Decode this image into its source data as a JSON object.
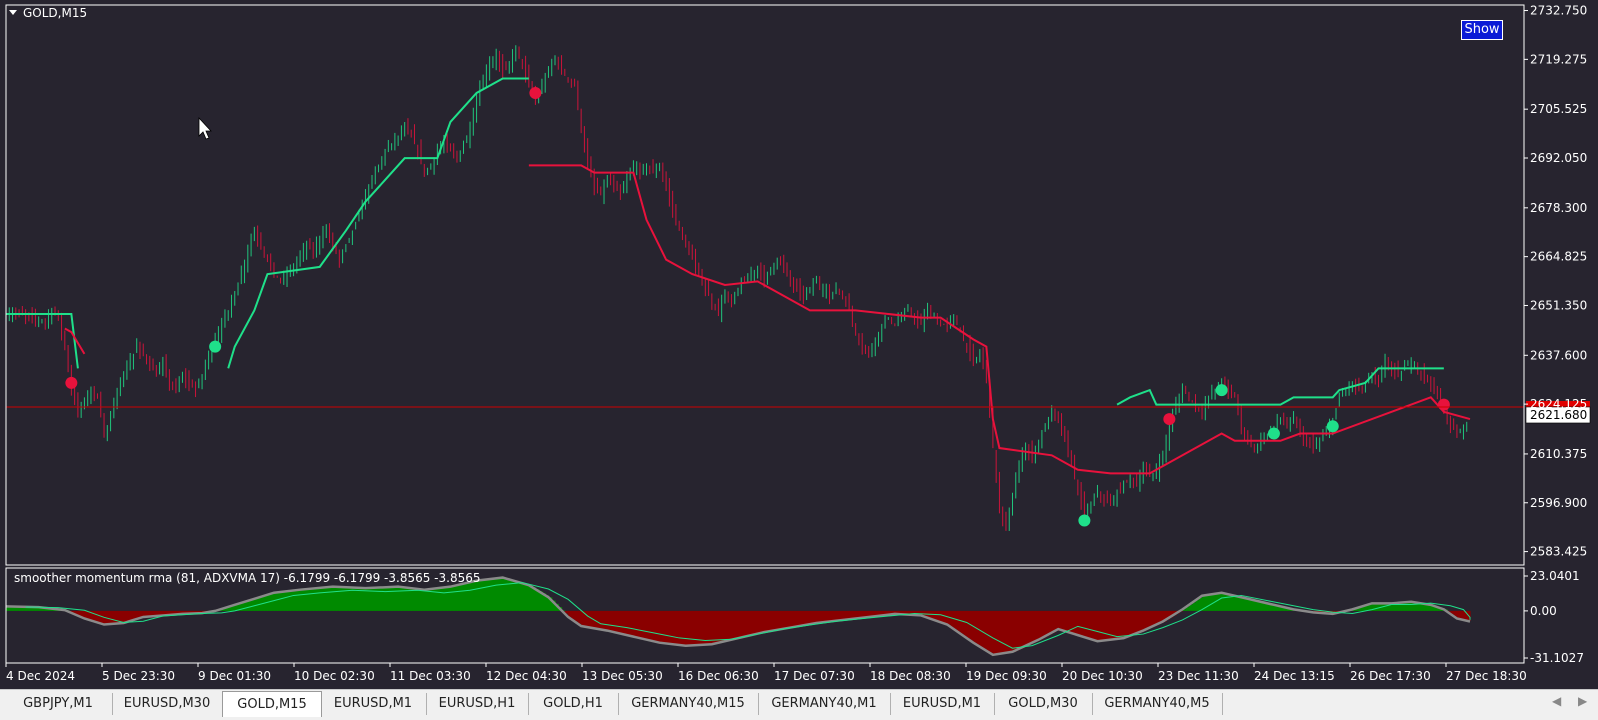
{
  "window": {
    "symbol_title": "GOLD,M15",
    "show_button": "Show"
  },
  "colors": {
    "background": "#27242f",
    "bull": "#1fe08a",
    "bear": "#e8123c",
    "hist_pos": "#008a00",
    "hist_neg": "#8a0000",
    "line_gray": "#8a8a8a",
    "price_line": "#cc0000"
  },
  "indicator": {
    "label": "smoother momentum rma (81, ADXVMA 17) -6.1799 -6.1799 -3.8565 -3.8565",
    "ticks": [
      "23.0401",
      "0.00",
      "-31.1027"
    ]
  },
  "chart_data": {
    "type": "candlestick",
    "price_axis": {
      "ticks": [
        "2732.750",
        "2719.275",
        "2705.525",
        "2692.050",
        "2678.300",
        "2664.825",
        "2651.350",
        "2637.600",
        "2624.125",
        "2610.375",
        "2596.900",
        "2583.425"
      ],
      "ylim": [
        2580.0,
        2734.0
      ],
      "current_price": "2621.680"
    },
    "time_axis": {
      "labels": [
        "4 Dec 2024",
        "5 Dec 23:30",
        "9 Dec 01:30",
        "10 Dec 02:30",
        "11 Dec 03:30",
        "12 Dec 04:30",
        "13 Dec 05:30",
        "16 Dec 06:30",
        "17 Dec 07:30",
        "18 Dec 08:30",
        "19 Dec 09:30",
        "20 Dec 10:30",
        "23 Dec 11:30",
        "24 Dec 13:15",
        "26 Dec 17:30",
        "27 Dec 18:30"
      ]
    },
    "price_path": [
      [
        0,
        2649
      ],
      [
        2,
        2649
      ],
      [
        4,
        2648
      ],
      [
        6,
        2647
      ],
      [
        7,
        2650
      ],
      [
        8,
        2648
      ],
      [
        9,
        2640
      ],
      [
        10,
        2628
      ],
      [
        11,
        2622
      ],
      [
        12,
        2625
      ],
      [
        13,
        2628
      ],
      [
        14,
        2626
      ],
      [
        15,
        2616
      ],
      [
        16,
        2620
      ],
      [
        17,
        2628
      ],
      [
        18,
        2632
      ],
      [
        19,
        2636
      ],
      [
        20,
        2640
      ],
      [
        21,
        2638
      ],
      [
        22,
        2635
      ],
      [
        23,
        2632
      ],
      [
        24,
        2635
      ],
      [
        25,
        2630
      ],
      [
        26,
        2628
      ],
      [
        27,
        2632
      ],
      [
        28,
        2630
      ],
      [
        29,
        2628
      ],
      [
        30,
        2632
      ],
      [
        31,
        2638
      ],
      [
        32,
        2642
      ],
      [
        33,
        2646
      ],
      [
        34,
        2650
      ],
      [
        35,
        2655
      ],
      [
        36,
        2660
      ],
      [
        37,
        2667
      ],
      [
        38,
        2672
      ],
      [
        39,
        2668
      ],
      [
        40,
        2664
      ],
      [
        41,
        2660
      ],
      [
        42,
        2658
      ],
      [
        43,
        2660
      ],
      [
        44,
        2662
      ],
      [
        45,
        2665
      ],
      [
        46,
        2668
      ],
      [
        47,
        2666
      ],
      [
        48,
        2670
      ],
      [
        49,
        2672
      ],
      [
        50,
        2668
      ],
      [
        51,
        2664
      ],
      [
        52,
        2668
      ],
      [
        53,
        2672
      ],
      [
        54,
        2676
      ],
      [
        55,
        2682
      ],
      [
        56,
        2686
      ],
      [
        57,
        2690
      ],
      [
        58,
        2694
      ],
      [
        59,
        2696
      ],
      [
        60,
        2698
      ],
      [
        61,
        2700
      ],
      [
        62,
        2698
      ],
      [
        63,
        2694
      ],
      [
        64,
        2688
      ],
      [
        65,
        2690
      ],
      [
        66,
        2694
      ],
      [
        67,
        2696
      ],
      [
        68,
        2694
      ],
      [
        69,
        2692
      ],
      [
        70,
        2696
      ],
      [
        71,
        2700
      ],
      [
        72,
        2708
      ],
      [
        73,
        2714
      ],
      [
        74,
        2718
      ],
      [
        75,
        2720
      ],
      [
        76,
        2716
      ],
      [
        77,
        2718
      ],
      [
        78,
        2722
      ],
      [
        79,
        2718
      ],
      [
        80,
        2712
      ],
      [
        81,
        2708
      ],
      [
        82,
        2712
      ],
      [
        83,
        2716
      ],
      [
        84,
        2720
      ],
      [
        85,
        2716
      ],
      [
        86,
        2714
      ],
      [
        87,
        2712
      ],
      [
        88,
        2700
      ],
      [
        89,
        2690
      ],
      [
        90,
        2684
      ],
      [
        91,
        2682
      ],
      [
        92,
        2686
      ],
      [
        93,
        2684
      ],
      [
        94,
        2682
      ],
      [
        95,
        2686
      ],
      [
        96,
        2690
      ],
      [
        97,
        2688
      ],
      [
        98,
        2690
      ],
      [
        99,
        2688
      ],
      [
        100,
        2690
      ],
      [
        101,
        2684
      ],
      [
        102,
        2678
      ],
      [
        103,
        2672
      ],
      [
        104,
        2668
      ],
      [
        105,
        2664
      ],
      [
        106,
        2660
      ],
      [
        107,
        2656
      ],
      [
        108,
        2652
      ],
      [
        109,
        2650
      ],
      [
        110,
        2654
      ],
      [
        111,
        2652
      ],
      [
        112,
        2656
      ],
      [
        113,
        2658
      ],
      [
        114,
        2660
      ],
      [
        115,
        2662
      ],
      [
        116,
        2658
      ],
      [
        117,
        2662
      ],
      [
        118,
        2664
      ],
      [
        119,
        2662
      ],
      [
        120,
        2658
      ],
      [
        121,
        2656
      ],
      [
        122,
        2654
      ],
      [
        123,
        2656
      ],
      [
        124,
        2658
      ],
      [
        125,
        2656
      ],
      [
        126,
        2654
      ],
      [
        127,
        2656
      ],
      [
        128,
        2654
      ],
      [
        129,
        2650
      ],
      [
        130,
        2644
      ],
      [
        131,
        2640
      ],
      [
        132,
        2638
      ],
      [
        133,
        2642
      ],
      [
        134,
        2646
      ],
      [
        135,
        2648
      ],
      [
        136,
        2646
      ],
      [
        137,
        2648
      ],
      [
        138,
        2650
      ],
      [
        139,
        2648
      ],
      [
        140,
        2646
      ],
      [
        141,
        2650
      ],
      [
        142,
        2648
      ],
      [
        143,
        2646
      ],
      [
        144,
        2646
      ],
      [
        145,
        2648
      ],
      [
        146,
        2644
      ],
      [
        147,
        2640
      ],
      [
        148,
        2636
      ],
      [
        149,
        2638
      ],
      [
        150,
        2632
      ],
      [
        151,
        2612
      ],
      [
        152,
        2595
      ],
      [
        153,
        2590
      ],
      [
        154,
        2598
      ],
      [
        155,
        2608
      ],
      [
        156,
        2612
      ],
      [
        157,
        2610
      ],
      [
        158,
        2614
      ],
      [
        159,
        2618
      ],
      [
        160,
        2622
      ],
      [
        161,
        2620
      ],
      [
        162,
        2614
      ],
      [
        163,
        2608
      ],
      [
        164,
        2600
      ],
      [
        165,
        2594
      ],
      [
        166,
        2596
      ],
      [
        167,
        2600
      ],
      [
        168,
        2598
      ],
      [
        169,
        2596
      ],
      [
        170,
        2600
      ],
      [
        171,
        2602
      ],
      [
        172,
        2604
      ],
      [
        173,
        2602
      ],
      [
        174,
        2606
      ],
      [
        175,
        2604
      ],
      [
        176,
        2606
      ],
      [
        177,
        2610
      ],
      [
        178,
        2618
      ],
      [
        179,
        2624
      ],
      [
        180,
        2628
      ],
      [
        181,
        2626
      ],
      [
        182,
        2624
      ],
      [
        183,
        2622
      ],
      [
        184,
        2626
      ],
      [
        185,
        2628
      ],
      [
        186,
        2630
      ],
      [
        187,
        2628
      ],
      [
        188,
        2626
      ],
      [
        189,
        2618
      ],
      [
        190,
        2614
      ],
      [
        191,
        2612
      ],
      [
        192,
        2614
      ],
      [
        193,
        2616
      ],
      [
        194,
        2618
      ],
      [
        195,
        2620
      ],
      [
        196,
        2618
      ],
      [
        197,
        2620
      ],
      [
        198,
        2616
      ],
      [
        199,
        2614
      ],
      [
        200,
        2612
      ],
      [
        201,
        2614
      ],
      [
        202,
        2616
      ],
      [
        203,
        2620
      ],
      [
        204,
        2626
      ],
      [
        205,
        2628
      ],
      [
        206,
        2630
      ],
      [
        207,
        2628
      ],
      [
        208,
        2630
      ],
      [
        209,
        2632
      ],
      [
        210,
        2630
      ],
      [
        211,
        2636
      ],
      [
        212,
        2634
      ],
      [
        213,
        2632
      ],
      [
        214,
        2634
      ],
      [
        215,
        2636
      ],
      [
        216,
        2634
      ],
      [
        217,
        2632
      ],
      [
        218,
        2630
      ],
      [
        219,
        2626
      ],
      [
        220,
        2622
      ],
      [
        221,
        2618
      ],
      [
        222,
        2616
      ],
      [
        223,
        2618
      ],
      [
        224,
        2620
      ]
    ],
    "upper_line": [
      [
        0,
        2649
      ],
      [
        10,
        2649
      ],
      [
        11,
        2634
      ],
      [
        34,
        2634
      ],
      [
        35,
        2640
      ],
      [
        38,
        2650
      ],
      [
        40,
        2660
      ],
      [
        48,
        2662
      ],
      [
        50,
        2667
      ],
      [
        52,
        2672
      ],
      [
        55,
        2680
      ],
      [
        58,
        2686
      ],
      [
        61,
        2692
      ],
      [
        66,
        2692
      ],
      [
        68,
        2702
      ],
      [
        72,
        2710
      ],
      [
        76,
        2714
      ],
      [
        80,
        2714
      ],
      [
        148,
        2624
      ],
      [
        170,
        2624
      ],
      [
        172,
        2626
      ],
      [
        175,
        2628
      ],
      [
        176,
        2624
      ],
      [
        178,
        2624
      ],
      [
        185,
        2624
      ],
      [
        195,
        2624
      ],
      [
        197,
        2626
      ],
      [
        203,
        2626
      ],
      [
        204,
        2628
      ],
      [
        208,
        2630
      ],
      [
        210,
        2634
      ],
      [
        214,
        2634
      ],
      [
        217,
        2634
      ],
      [
        220,
        2634
      ]
    ],
    "lower_line": [
      [
        9,
        2645
      ],
      [
        10,
        2644
      ],
      [
        12,
        2638
      ],
      [
        34,
        2638
      ],
      [
        80,
        2690
      ],
      [
        88,
        2690
      ],
      [
        90,
        2688
      ],
      [
        96,
        2688
      ],
      [
        98,
        2675
      ],
      [
        101,
        2664
      ],
      [
        105,
        2660
      ],
      [
        110,
        2657
      ],
      [
        115,
        2658
      ],
      [
        118,
        2655
      ],
      [
        121,
        2652
      ],
      [
        123,
        2650
      ],
      [
        130,
        2650
      ],
      [
        135,
        2649
      ],
      [
        140,
        2648
      ],
      [
        143,
        2648
      ],
      [
        148,
        2642
      ],
      [
        150,
        2640
      ],
      [
        151,
        2620
      ],
      [
        152,
        2612
      ],
      [
        160,
        2610
      ],
      [
        164,
        2606
      ],
      [
        169,
        2605
      ],
      [
        172,
        2605
      ],
      [
        175,
        2605
      ],
      [
        186,
        2616
      ],
      [
        188,
        2614
      ],
      [
        190,
        2614
      ],
      [
        195,
        2614
      ],
      [
        198,
        2616
      ],
      [
        202,
        2616
      ],
      [
        203,
        2616
      ],
      [
        218,
        2626
      ],
      [
        220,
        2622
      ],
      [
        224,
        2620
      ]
    ],
    "signals": [
      {
        "i": 10,
        "side": "sell"
      },
      {
        "i": 32,
        "side": "buy"
      },
      {
        "i": 81,
        "side": "sell"
      },
      {
        "i": 165,
        "side": "buy"
      },
      {
        "i": 178,
        "side": "sell"
      },
      {
        "i": 186,
        "side": "buy"
      },
      {
        "i": 194,
        "side": "buy"
      },
      {
        "i": 203,
        "side": "buy"
      },
      {
        "i": 220,
        "side": "sell"
      }
    ],
    "momentum": {
      "ylim": [
        -31.1027,
        23.0401
      ],
      "values": [
        [
          0,
          3
        ],
        [
          5,
          2.5
        ],
        [
          9,
          0.5
        ],
        [
          12,
          -5
        ],
        [
          15,
          -9
        ],
        [
          18,
          -8
        ],
        [
          21,
          -4
        ],
        [
          24,
          -3
        ],
        [
          27,
          -2
        ],
        [
          30,
          -1.5
        ],
        [
          32,
          0
        ],
        [
          35,
          4
        ],
        [
          38,
          8
        ],
        [
          41,
          12
        ],
        [
          45,
          14
        ],
        [
          50,
          16
        ],
        [
          55,
          15
        ],
        [
          60,
          16
        ],
        [
          64,
          14
        ],
        [
          68,
          16
        ],
        [
          72,
          20
        ],
        [
          76,
          22
        ],
        [
          80,
          17
        ],
        [
          83,
          9
        ],
        [
          86,
          -4
        ],
        [
          88,
          -10
        ],
        [
          92,
          -13
        ],
        [
          96,
          -17
        ],
        [
          100,
          -21
        ],
        [
          104,
          -23
        ],
        [
          108,
          -22
        ],
        [
          112,
          -18
        ],
        [
          116,
          -14
        ],
        [
          120,
          -11
        ],
        [
          124,
          -8
        ],
        [
          128,
          -6
        ],
        [
          132,
          -4
        ],
        [
          136,
          -2
        ],
        [
          140,
          -3
        ],
        [
          144,
          -9
        ],
        [
          148,
          -21
        ],
        [
          151,
          -29
        ],
        [
          154,
          -27
        ],
        [
          158,
          -19
        ],
        [
          161,
          -12
        ],
        [
          164,
          -16
        ],
        [
          167,
          -20
        ],
        [
          171,
          -18
        ],
        [
          174,
          -13
        ],
        [
          177,
          -7
        ],
        [
          180,
          1
        ],
        [
          183,
          10
        ],
        [
          186,
          12
        ],
        [
          190,
          8
        ],
        [
          194,
          4
        ],
        [
          197,
          1
        ],
        [
          200,
          -1
        ],
        [
          203,
          -2
        ],
        [
          206,
          1
        ],
        [
          209,
          5
        ],
        [
          212,
          5
        ],
        [
          215,
          6
        ],
        [
          218,
          4
        ],
        [
          220,
          1
        ],
        [
          222,
          -5
        ],
        [
          224,
          -7
        ]
      ]
    }
  },
  "tabs": [
    {
      "label": "GBPJPY,M1",
      "active": false
    },
    {
      "label": "EURUSD,M30",
      "active": false
    },
    {
      "label": "GOLD,M15",
      "active": true
    },
    {
      "label": "EURUSD,M1",
      "active": false
    },
    {
      "label": "EURUSD,H1",
      "active": false
    },
    {
      "label": "GOLD,H1",
      "active": false
    },
    {
      "label": "GERMANY40,M15",
      "active": false
    },
    {
      "label": "GERMANY40,M1",
      "active": false
    },
    {
      "label": "EURUSD,M1",
      "active": false
    },
    {
      "label": "GOLD,M30",
      "active": false
    },
    {
      "label": "GERMANY40,M5",
      "active": false
    }
  ]
}
